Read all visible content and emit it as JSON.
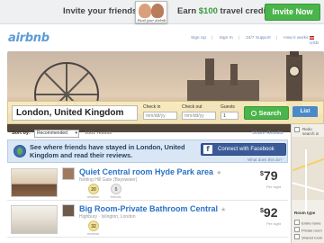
{
  "promo_bar": {
    "invite_text": "Invite your friends",
    "photo_caption": "Fund your Airbnb",
    "earn_prefix": "Earn ",
    "earn_amount": "$100",
    "earn_suffix": " travel credit",
    "invite_button": "Invite Now"
  },
  "header": {
    "logo": "airbnb",
    "nav": [
      "Sign Up",
      "Sign In",
      "24/7 Support",
      "How it works"
    ],
    "currency": "USD"
  },
  "search": {
    "location_value": "London, United Kingdom",
    "checkin_label": "Check in",
    "checkin_placeholder": "mm/dd/yy",
    "checkout_label": "Check out",
    "checkout_placeholder": "mm/dd/yy",
    "guests_label": "Guests",
    "guests_value": "1",
    "search_button": "Search"
  },
  "view_tabs": {
    "list": "List"
  },
  "sort": {
    "label": "Sort by:",
    "selected": "Recommended",
    "results_count": "1861 results",
    "share": "Share Results"
  },
  "facebook_promo": {
    "text": "See where friends have stayed in London, United Kingdom and read their reviews.",
    "button": "Connect with Facebook",
    "what_link": "What does this do?"
  },
  "listings": [
    {
      "title": "Quiet Central room Hyde Park area",
      "location": "Notting Hill Gate (Bayswater)",
      "reviews": "20",
      "reviews_label": "reviews",
      "friends": "5",
      "friends_label": "friends",
      "currency": "$",
      "price": "79",
      "per": "Per night"
    },
    {
      "title": "Big Room-Private Bathroom Central",
      "location": "Highbury · Islington, London",
      "reviews": "32",
      "reviews_label": "reviews",
      "currency": "$",
      "price": "92",
      "per": "Per night"
    }
  ],
  "map_panel": {
    "redo_label": "Redo search in map",
    "room_type_label": "Room type",
    "options": [
      "Entire home",
      "Private room",
      "Shared room"
    ]
  },
  "colors": {
    "accent_green": "#4ab54a",
    "link_blue": "#2a72c6",
    "facebook_blue": "#3b5b98"
  }
}
